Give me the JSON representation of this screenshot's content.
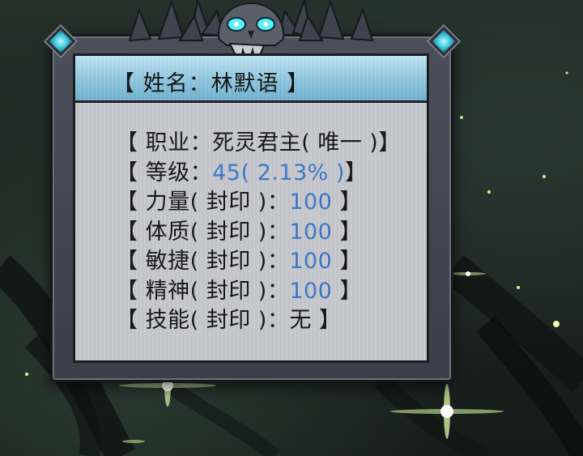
{
  "panel": {
    "title": "【 姓名：林默语 】"
  },
  "stats": [
    {
      "label": "【 职业：死灵君主( 唯一 )】"
    },
    {
      "prefix": "【 等级：",
      "value": "45",
      "paren_value": "( 2.13% )",
      "suffix": "】"
    },
    {
      "prefix": "【 力量( 封印 )：",
      "value": "100",
      "suffix": " 】"
    },
    {
      "prefix": "【 体质( 封印 )：",
      "value": "100",
      "suffix": " 】"
    },
    {
      "prefix": "【 敏捷( 封印 )：",
      "value": "100",
      "suffix": " 】"
    },
    {
      "prefix": "【 精神( 封印 )：",
      "value": "100",
      "suffix": " 】"
    },
    {
      "label": "【 技能( 封印 )：无 】"
    }
  ],
  "colors": {
    "title_bar": "#8fc7df",
    "panel_bg": "#c7c8cd",
    "value_blue": "#3a76c8",
    "gem_cyan": "#4fd2e6",
    "skull_eye": "#5cf0ff",
    "sparkle": "#e9ffb0"
  },
  "icons": [
    "skull-ornament-icon",
    "gem-left-icon",
    "gem-right-icon"
  ]
}
